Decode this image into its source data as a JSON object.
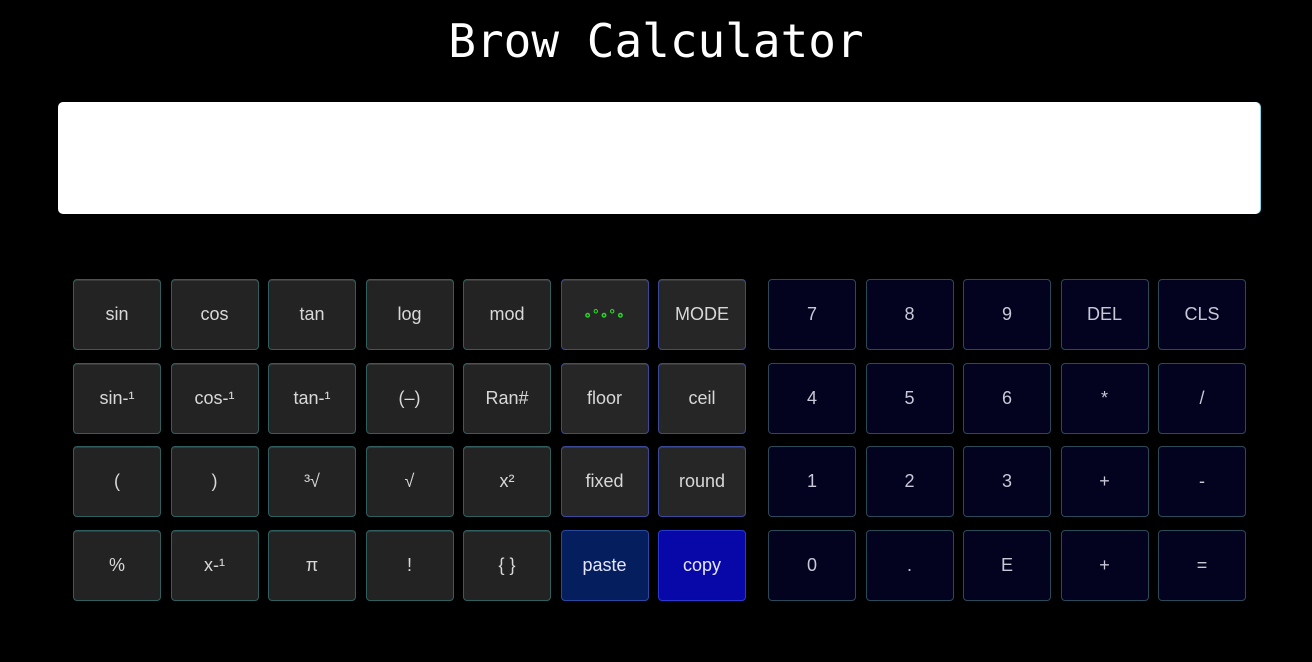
{
  "app": {
    "title": "Brow Calculator"
  },
  "display": {
    "value": "",
    "placeholder": ""
  },
  "left_pad": {
    "rows": [
      [
        {
          "label": "sin",
          "name": "sin-button",
          "kind": "fn"
        },
        {
          "label": "cos",
          "name": "cos-button",
          "kind": "fn"
        },
        {
          "label": "tan",
          "name": "tan-button",
          "kind": "fn"
        },
        {
          "label": "log",
          "name": "log-button",
          "kind": "fn"
        },
        {
          "label": "mod",
          "name": "mod-button",
          "kind": "fn"
        },
        {
          "label": "∘°∘°∘",
          "name": "settings-dots-button",
          "kind": "op",
          "icon": "dots-icon"
        },
        {
          "label": "MODE",
          "name": "mode-button",
          "kind": "op"
        }
      ],
      [
        {
          "label": "sin-¹",
          "name": "asin-button",
          "kind": "fn"
        },
        {
          "label": "cos-¹",
          "name": "acos-button",
          "kind": "fn"
        },
        {
          "label": "tan-¹",
          "name": "atan-button",
          "kind": "fn"
        },
        {
          "label": "(–)",
          "name": "negate-button",
          "kind": "fn"
        },
        {
          "label": "Ran#",
          "name": "random-button",
          "kind": "fn"
        },
        {
          "label": "floor",
          "name": "floor-button",
          "kind": "op"
        },
        {
          "label": "ceil",
          "name": "ceil-button",
          "kind": "op"
        }
      ],
      [
        {
          "label": "(",
          "name": "open-paren-button",
          "kind": "fn"
        },
        {
          "label": ")",
          "name": "close-paren-button",
          "kind": "fn"
        },
        {
          "label": "³√",
          "name": "cube-root-button",
          "kind": "fn"
        },
        {
          "label": "√",
          "name": "square-root-button",
          "kind": "fn"
        },
        {
          "label": "x²",
          "name": "square-button",
          "kind": "fn"
        },
        {
          "label": "fixed",
          "name": "fixed-button",
          "kind": "op"
        },
        {
          "label": "round",
          "name": "round-button",
          "kind": "op"
        }
      ],
      [
        {
          "label": "%",
          "name": "percent-button",
          "kind": "fn"
        },
        {
          "label": "x-¹",
          "name": "reciprocal-button",
          "kind": "fn"
        },
        {
          "label": "π",
          "name": "pi-button",
          "kind": "fn"
        },
        {
          "label": "!",
          "name": "factorial-button",
          "kind": "fn"
        },
        {
          "label": "{ }",
          "name": "braces-button",
          "kind": "fn"
        },
        {
          "label": "paste",
          "name": "paste-button",
          "kind": "paste"
        },
        {
          "label": "copy",
          "name": "copy-button",
          "kind": "copy"
        }
      ]
    ]
  },
  "right_pad": {
    "rows": [
      [
        {
          "label": "7",
          "name": "digit-7-button"
        },
        {
          "label": "8",
          "name": "digit-8-button"
        },
        {
          "label": "9",
          "name": "digit-9-button"
        },
        {
          "label": "DEL",
          "name": "delete-button"
        },
        {
          "label": "CLS",
          "name": "clear-button"
        }
      ],
      [
        {
          "label": "4",
          "name": "digit-4-button"
        },
        {
          "label": "5",
          "name": "digit-5-button"
        },
        {
          "label": "6",
          "name": "digit-6-button"
        },
        {
          "label": "*",
          "name": "multiply-button"
        },
        {
          "label": "/",
          "name": "divide-button"
        }
      ],
      [
        {
          "label": "1",
          "name": "digit-1-button"
        },
        {
          "label": "2",
          "name": "digit-2-button"
        },
        {
          "label": "3",
          "name": "digit-3-button"
        },
        {
          "label": "+",
          "name": "plus-button"
        },
        {
          "label": "-",
          "name": "minus-button"
        }
      ],
      [
        {
          "label": "0",
          "name": "digit-0-button"
        },
        {
          "label": ".",
          "name": "decimal-point-button"
        },
        {
          "label": "E",
          "name": "exponent-button"
        },
        {
          "label": "+",
          "name": "plus-button-2"
        },
        {
          "label": "=",
          "name": "equals-button"
        }
      ]
    ]
  }
}
